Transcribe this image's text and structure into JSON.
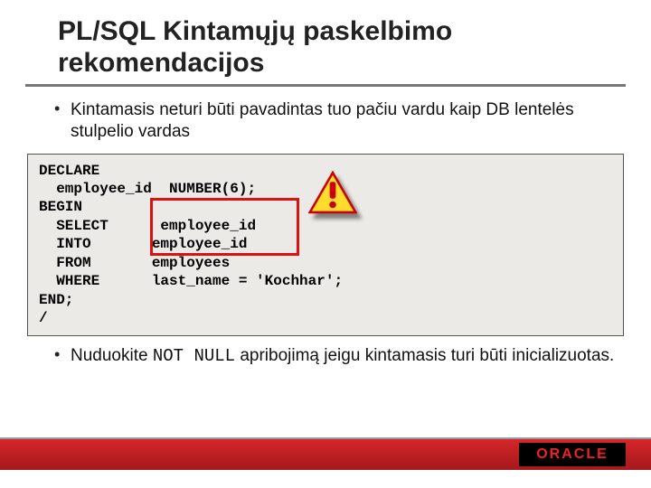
{
  "title": "PL/SQL Kintamųjų paskelbimo rekomendacijos",
  "bullets": {
    "b1": "Kintamasis neturi būti pavadintas tuo pačiu vardu kaip DB lentelės stulpelio vardas",
    "b2_pre": "Nuduokite ",
    "b2_code": "NOT NULL",
    "b2_post": " apribojimą jeigu kintamasis turi būti inicializuotas."
  },
  "code": {
    "l0": "DECLARE",
    "l1": "  employee_id  NUMBER(6);",
    "l2": "BEGIN",
    "l3": "  SELECT      employee_id",
    "l4": "  INTO       employee_id",
    "l5": "  FROM       employees",
    "l6": "  WHERE      last_name = 'Kochhar';",
    "l7": "END;",
    "l8": "/"
  },
  "logo": "ORACLE"
}
